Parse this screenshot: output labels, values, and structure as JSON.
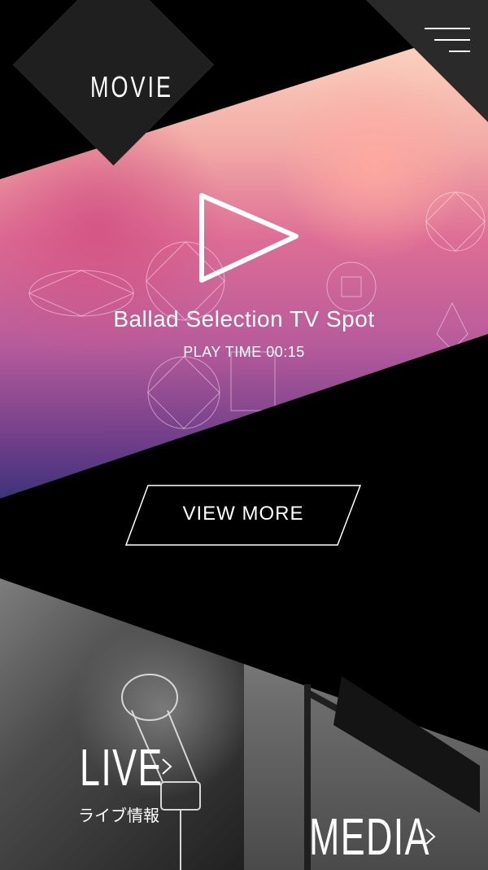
{
  "header": {
    "section_label": "MOVIE",
    "menu_icon": "hamburger-menu-icon"
  },
  "video": {
    "title": "Ballad Selection TV Spot",
    "play_time": "PLAY TIME 00:15",
    "play_icon": "play-icon"
  },
  "actions": {
    "view_more": "VIEW MORE"
  },
  "categories": [
    {
      "title": "LIVE",
      "subtitle": "ライブ情報",
      "icon": "chevron-right-icon"
    },
    {
      "title": "MEDIA",
      "icon": "chevron-right-icon"
    }
  ]
}
